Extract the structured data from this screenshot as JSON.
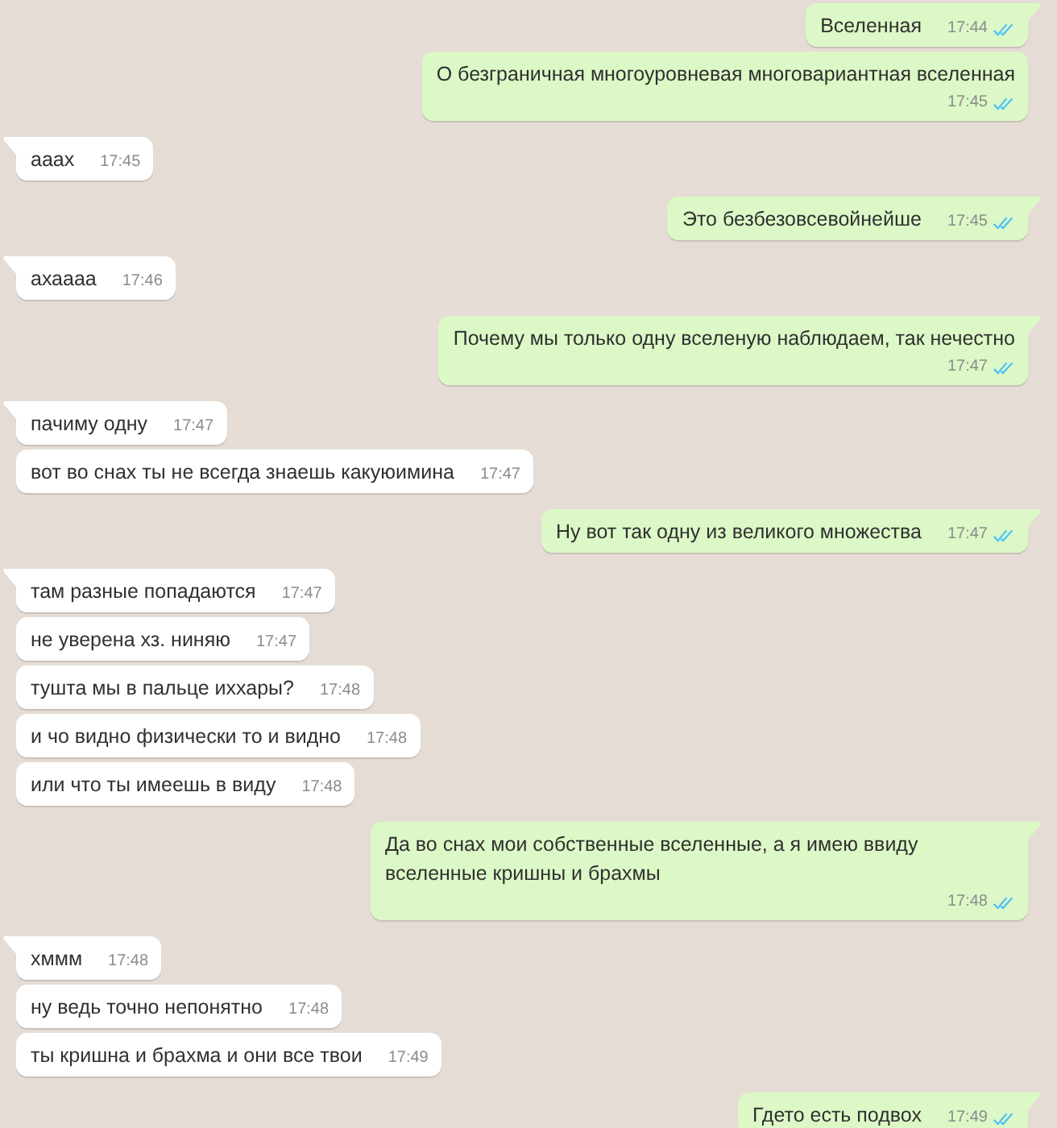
{
  "messages": [
    {
      "kind": "outgoing",
      "tail": true,
      "text": "Вселенная",
      "time": "17:44",
      "read": true
    },
    {
      "kind": "outgoing",
      "tail": false,
      "text": "О безграничная многоуровневая многовариантная вселенная",
      "time": "17:45",
      "read": true,
      "time_below": true
    },
    {
      "kind": "incoming",
      "tail": true,
      "text": "ааах",
      "time": "17:45"
    },
    {
      "kind": "outgoing",
      "tail": true,
      "text": "Это безбезовсевойнейше",
      "time": "17:45",
      "read": true
    },
    {
      "kind": "incoming",
      "tail": true,
      "text": "ахаааа",
      "time": "17:46"
    },
    {
      "kind": "outgoing",
      "tail": true,
      "text": "Почему мы только одну вселеную наблюдаем, так нечестно",
      "time": "17:47",
      "read": true,
      "time_below": true
    },
    {
      "kind": "incoming",
      "tail": true,
      "text": "пачиму одну",
      "time": "17:47"
    },
    {
      "kind": "incoming",
      "tail": false,
      "text": "вот во снах ты не всегда знаешь какуюимина",
      "time": "17:47"
    },
    {
      "kind": "outgoing",
      "tail": true,
      "text": "Ну вот так одну из великого множества",
      "time": "17:47",
      "read": true
    },
    {
      "kind": "incoming",
      "tail": true,
      "text": "там разные попадаются",
      "time": "17:47"
    },
    {
      "kind": "incoming",
      "tail": false,
      "text": "не уверена хз. ниняю",
      "time": "17:47"
    },
    {
      "kind": "incoming",
      "tail": false,
      "text": "тушта мы в пальце иххары?",
      "time": "17:48"
    },
    {
      "kind": "incoming",
      "tail": false,
      "text": "и чо видно физически то и видно",
      "time": "17:48"
    },
    {
      "kind": "incoming",
      "tail": false,
      "text": "или что ты имеешь в виду",
      "time": "17:48"
    },
    {
      "kind": "outgoing",
      "tail": true,
      "text": "Да во снах мои собственные вселенные, а я имею ввиду вселенные кришны и брахмы",
      "time": "17:48",
      "read": true,
      "time_below": true
    },
    {
      "kind": "incoming",
      "tail": true,
      "text": "хммм",
      "time": "17:48"
    },
    {
      "kind": "incoming",
      "tail": false,
      "text": "ну ведь точно непонятно",
      "time": "17:48"
    },
    {
      "kind": "incoming",
      "tail": false,
      "text": "ты кришна и брахма и они все твои",
      "time": "17:49"
    },
    {
      "kind": "outgoing",
      "tail": true,
      "text": "Гдето есть подвох",
      "time": "17:49",
      "read": true
    }
  ]
}
